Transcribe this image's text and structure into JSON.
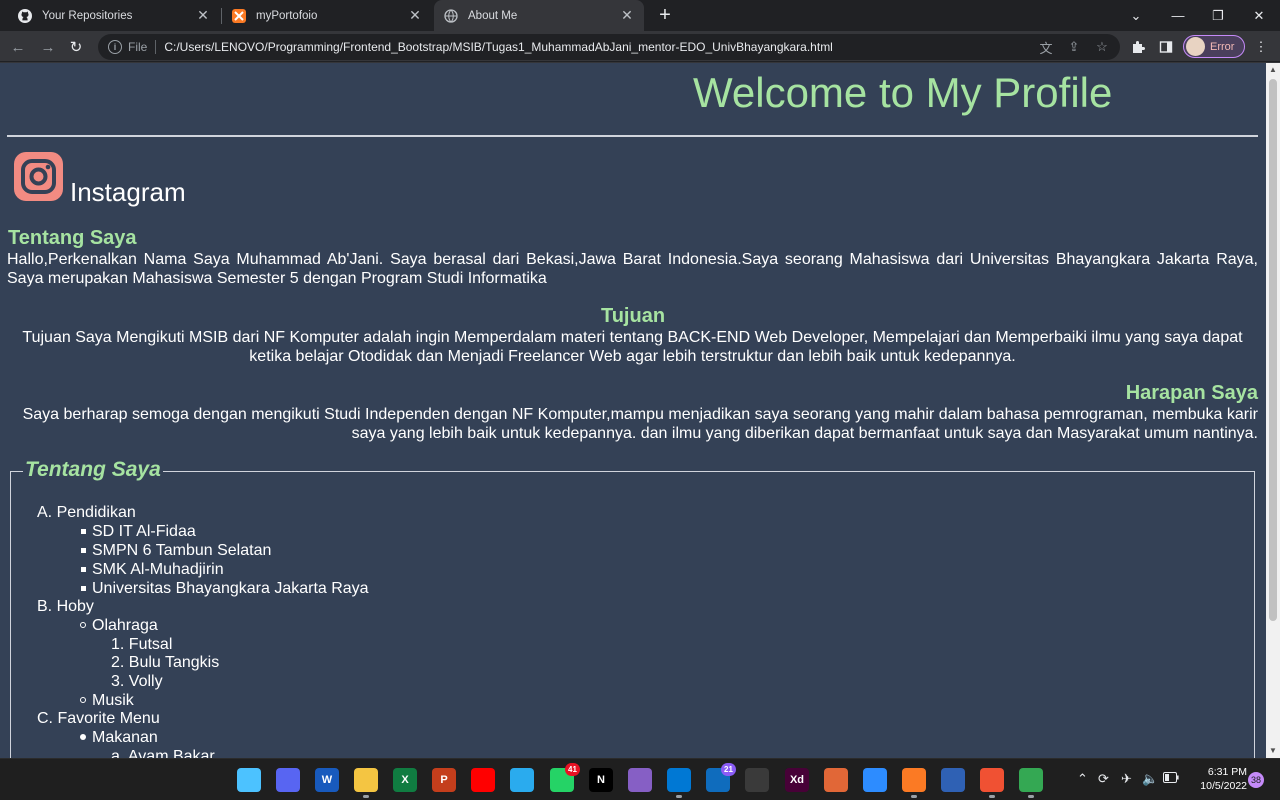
{
  "browser": {
    "tabs": [
      {
        "title": "Your Repositories",
        "icon": "github-icon"
      },
      {
        "title": "myPortofoio",
        "icon": "xampp-icon"
      },
      {
        "title": "About Me",
        "icon": "globe-icon",
        "active": true
      }
    ],
    "omnibox": {
      "scheme": "File",
      "url": "C:/Users/LENOVO/Programming/Frontend_Bootstrap/MSIB/Tugas1_MuhammadAbJani_mentor-EDO_UnivBhayangkara.html"
    },
    "profile_label": "Error"
  },
  "page": {
    "welcome": "Welcome to My Profile",
    "instagram_label": "Instagram",
    "tentang": {
      "heading": "Tentang Saya",
      "text": "Hallo,Perkenalkan Nama Saya Muhammad Ab'Jani. Saya berasal dari Bekasi,Jawa Barat Indonesia.Saya seorang Mahasiswa dari Universitas Bhayangkara Jakarta Raya, Saya merupakan Mahasiswa Semester 5 dengan Program Studi Informatika"
    },
    "tujuan": {
      "heading": "Tujuan",
      "text": "Tujuan Saya Mengikuti MSIB dari NF Komputer adalah ingin Memperdalam materi tentang BACK-END Web Developer, Mempelajari dan Memperbaiki ilmu yang saya dapat ketika belajar Otodidak dan Menjadi Freelancer Web agar lebih terstruktur dan lebih baik untuk kedepannya."
    },
    "harapan": {
      "heading": "Harapan Saya",
      "text": "Saya berharap semoga dengan mengikuti Studi Independen dengan NF Komputer,mampu menjadikan saya seorang yang mahir dalam bahasa pemrograman, membuka karir saya yang lebih baik untuk kedepannya. dan ilmu yang diberikan dapat bermanfaat untuk saya dan Masyarakat umum nantinya."
    },
    "fieldset": {
      "legend": "Tentang Saya",
      "pendidikan": {
        "marker": "A.",
        "label": "Pendidikan",
        "items": [
          "SD IT Al-Fidaa",
          "SMPN 6 Tambun Selatan",
          "SMK Al-Muhadjirin",
          "Universitas Bhayangkara Jakarta Raya"
        ]
      },
      "hoby": {
        "marker": "B.",
        "label": "Hoby",
        "olahraga": {
          "label": "Olahraga",
          "items": [
            {
              "marker": "1.",
              "label": "Futsal"
            },
            {
              "marker": "2.",
              "label": "Bulu Tangkis"
            },
            {
              "marker": "3.",
              "label": "Volly"
            }
          ]
        },
        "musik": "Musik"
      },
      "favorite": {
        "marker": "C.",
        "label": "Favorite Menu",
        "makanan": "Makanan",
        "sub_marker": "a.",
        "sub_item": "Ayam Bakar"
      }
    }
  },
  "taskbar": {
    "apps": [
      {
        "name": "windows-start-icon",
        "label": "",
        "color": "#4cc2ff"
      },
      {
        "name": "discord-icon",
        "label": "",
        "color": "#5865f2"
      },
      {
        "name": "word-icon",
        "label": "W",
        "color": "#185abd"
      },
      {
        "name": "file-explorer-icon",
        "label": "",
        "color": "#f4c542"
      },
      {
        "name": "excel-icon",
        "label": "X",
        "color": "#107c41"
      },
      {
        "name": "powerpoint-icon",
        "label": "P",
        "color": "#c43e1c"
      },
      {
        "name": "youtube-music-icon",
        "label": "",
        "color": "#ff0000"
      },
      {
        "name": "telegram-icon",
        "label": "",
        "color": "#2aabee"
      },
      {
        "name": "whatsapp-icon",
        "label": "",
        "color": "#25d366",
        "badge": "41"
      },
      {
        "name": "netflix-icon",
        "label": "N",
        "color": "#000000"
      },
      {
        "name": "visual-studio-icon",
        "label": "",
        "color": "#865fc5"
      },
      {
        "name": "vscode-icon",
        "label": "",
        "color": "#0078d4"
      },
      {
        "name": "mail-icon",
        "label": "",
        "color": "#0f6cbd",
        "badge": "21"
      },
      {
        "name": "snipping-tool-icon",
        "label": "",
        "color": "#3a3a3a"
      },
      {
        "name": "adobe-xd-icon",
        "label": "Xd",
        "color": "#470137"
      },
      {
        "name": "matlab-icon",
        "label": "",
        "color": "#e16737"
      },
      {
        "name": "zoom-icon",
        "label": "",
        "color": "#2d8cff"
      },
      {
        "name": "xampp-icon",
        "label": "",
        "color": "#fb7a24"
      },
      {
        "name": "virtualbox-icon",
        "label": "",
        "color": "#2f61b4"
      },
      {
        "name": "git-icon",
        "label": "",
        "color": "#f05133"
      },
      {
        "name": "chrome-icon",
        "label": "",
        "color": "#34a853"
      }
    ],
    "clock_time": "6:31 PM",
    "clock_date": "10/5/2022",
    "notification_count": "38"
  }
}
